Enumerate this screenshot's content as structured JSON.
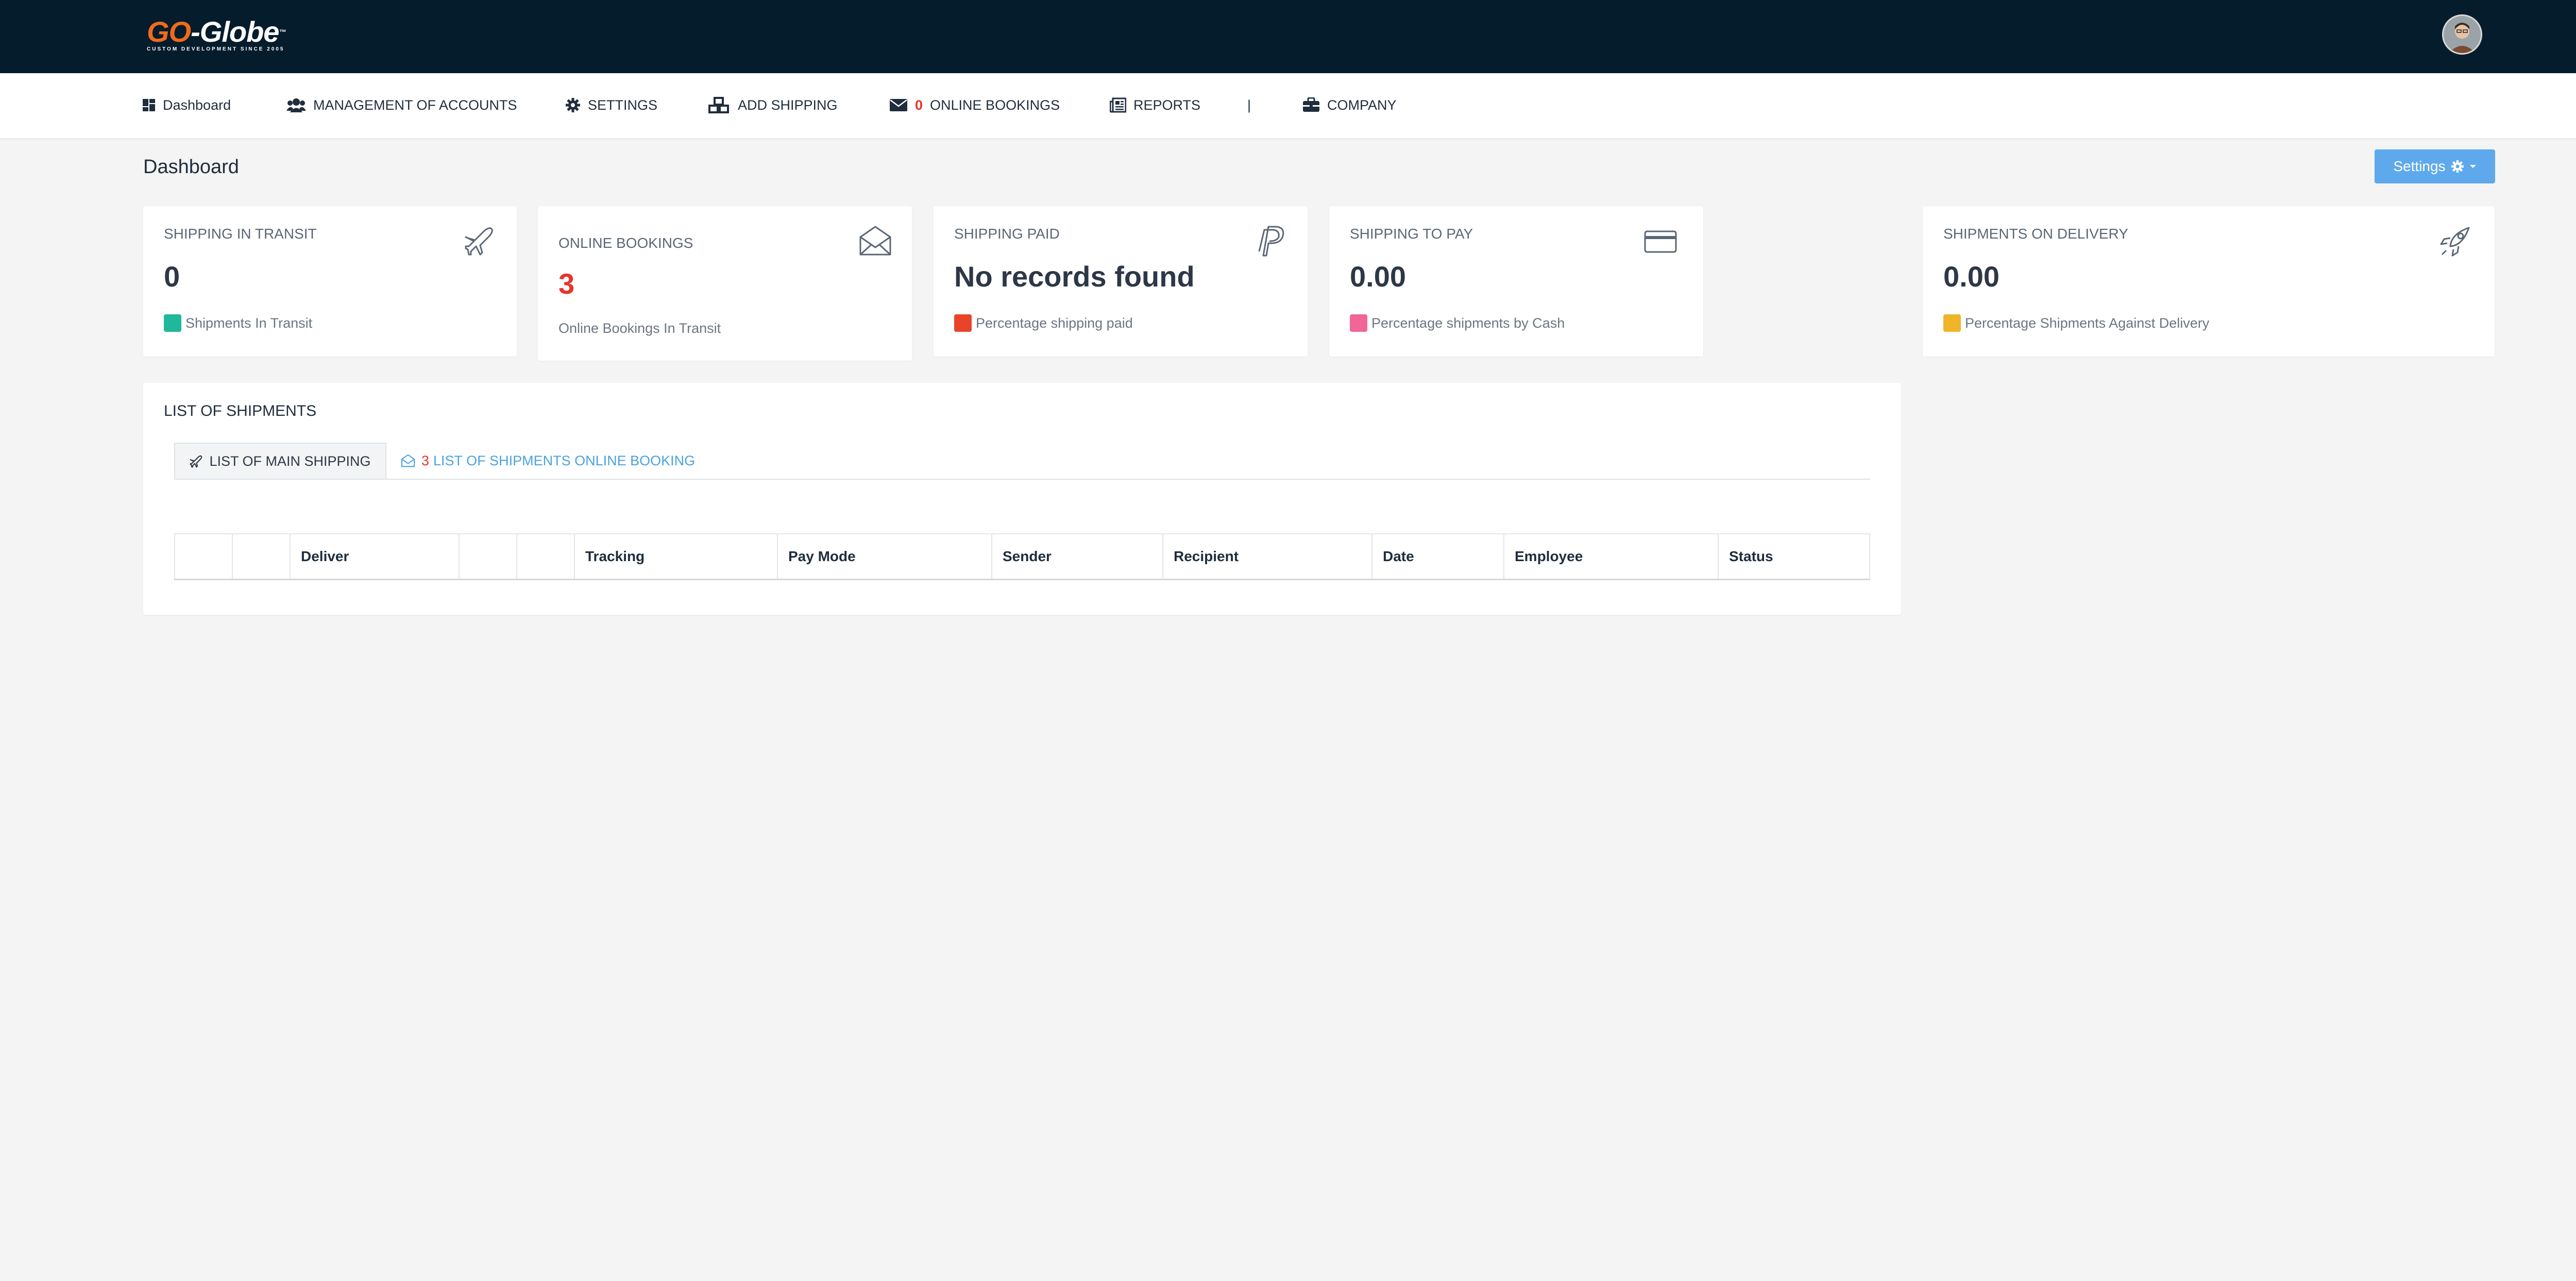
{
  "header": {
    "logo": {
      "word1": "GO",
      "word2": "-Globe",
      "tm": "™",
      "tagline": "CUSTOM DEVELOPMENT SINCE 2005"
    },
    "avatar_alt": "user avatar"
  },
  "nav": {
    "items": [
      {
        "label": "Dashboard",
        "icon": "dashboard-icon"
      },
      {
        "label": "MANAGEMENT OF ACCOUNTS",
        "icon": "users-icon"
      },
      {
        "label": "SETTINGS",
        "icon": "gear-icon"
      },
      {
        "label": "ADD SHIPPING",
        "icon": "cubes-icon"
      },
      {
        "label": "ONLINE BOOKINGS",
        "icon": "envelope-icon",
        "count": "0"
      },
      {
        "label": "REPORTS",
        "icon": "newspaper-icon"
      },
      {
        "label": "|",
        "icon": ""
      },
      {
        "label": "COMPANY",
        "icon": "briefcase-icon"
      }
    ]
  },
  "page": {
    "title": "Dashboard",
    "settings_label": "Settings"
  },
  "cards": [
    {
      "title": "SHIPPING IN TRANSIT",
      "value": "0",
      "footer": "Shipments In Transit",
      "icon": "plane-icon",
      "color": "#1fb89a"
    },
    {
      "title": "ONLINE BOOKINGS",
      "value": "3",
      "footer": "Online Bookings In Transit",
      "icon": "envelope-open-icon",
      "value_color": "#e8342a"
    },
    {
      "title": "SHIPPING PAID",
      "value": "No records found",
      "footer": "Percentage shipping paid",
      "icon": "paypal-icon",
      "color": "#e8442a"
    },
    {
      "title": "SHIPPING TO PAY",
      "value": "0.00",
      "footer": "Percentage shipments by Cash",
      "icon": "credit-card-icon",
      "color": "#f06696"
    },
    {
      "title": "SHIPMENTS ON DELIVERY",
      "value": "0.00",
      "footer": "Percentage Shipments Against Delivery",
      "icon": "rocket-icon",
      "color": "#f0b429"
    }
  ],
  "shipments": {
    "title": "LIST OF SHIPMENTS",
    "tabs": [
      {
        "label": "LIST OF MAIN SHIPPING",
        "icon": "plane-icon"
      },
      {
        "count": "3",
        "label": "LIST OF SHIPMENTS ONLINE BOOKING",
        "icon": "envelope-open-icon"
      }
    ],
    "columns": [
      "",
      "",
      "Deliver",
      "",
      "",
      "Tracking",
      "Pay Mode",
      "Sender",
      "Recipient",
      "Date",
      "Employee",
      "Status"
    ]
  },
  "colors": {
    "topbar": "#051c2c",
    "accent": "#5ea9ec",
    "danger": "#e8342a"
  }
}
